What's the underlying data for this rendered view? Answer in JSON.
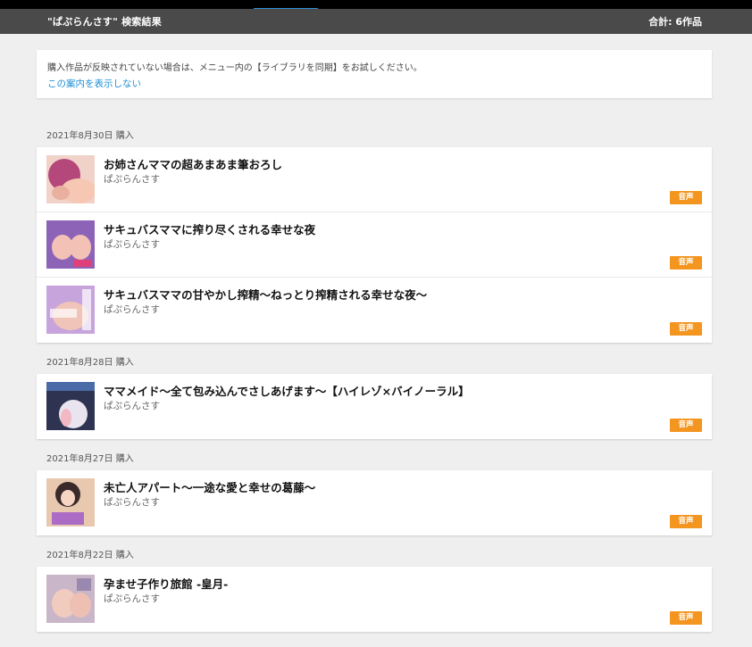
{
  "header": {
    "title": "\"ぱぷらんさす\" 検索結果",
    "total": "合計: 6作品"
  },
  "notice": {
    "text": "購入作品が反映されていない場合は、メニュー内の【ライブラリを同期】をお試しください。",
    "link": "この案内を表示しない"
  },
  "groups": [
    {
      "date": "2021年8月30日 購入",
      "items": [
        {
          "title": "お姉さんママの超あまあま筆おろし",
          "circle": "ぱぷらんさす",
          "badge": "音声",
          "thumb_color": "#c48aa6"
        },
        {
          "title": "サキュバスママに搾り尽くされる幸せな夜",
          "circle": "ぱぷらんさす",
          "badge": "音声",
          "thumb_color": "#9b77c4"
        },
        {
          "title": "サキュバスママの甘やかし搾精～ねっとり搾精される幸せな夜～",
          "circle": "ぱぷらんさす",
          "badge": "音声",
          "thumb_color": "#b48bd0"
        }
      ]
    },
    {
      "date": "2021年8月28日 購入",
      "items": [
        {
          "title": "ママメイド～全て包み込んでさしあげます～【ハイレゾ×バイノーラル】",
          "circle": "ぱぷらんさす",
          "badge": "音声",
          "thumb_color": "#5a6a9c"
        }
      ]
    },
    {
      "date": "2021年8月27日 購入",
      "items": [
        {
          "title": "未亡人アパート～一途な愛と幸せの葛藤～",
          "circle": "ぱぷらんさす",
          "badge": "音声",
          "thumb_color": "#d1a28b"
        }
      ]
    },
    {
      "date": "2021年8月22日 購入",
      "items": [
        {
          "title": "孕ませ子作り旅館 -皇月-",
          "circle": "ぱぷらんさす",
          "badge": "音声",
          "thumb_color": "#b59ab0"
        }
      ]
    }
  ]
}
